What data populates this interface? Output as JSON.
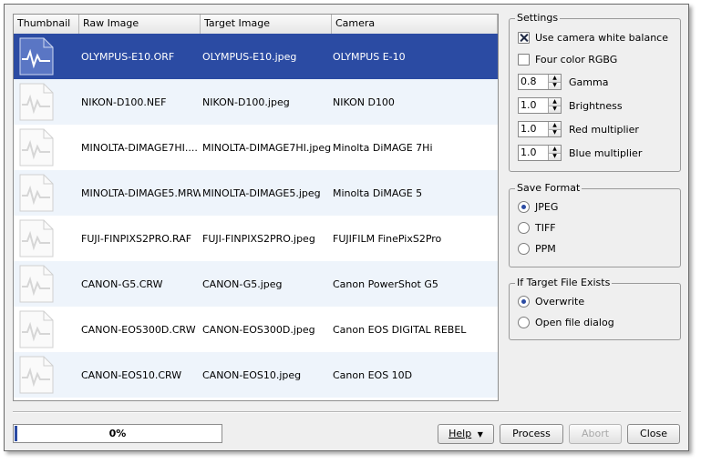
{
  "list": {
    "columns": [
      "Thumbnail",
      "Raw Image",
      "Target Image",
      "Camera"
    ],
    "rows": [
      {
        "raw": "OLYMPUS-E10.ORF",
        "target": "OLYMPUS-E10.jpeg",
        "camera": "OLYMPUS E-10"
      },
      {
        "raw": "NIKON-D100.NEF",
        "target": "NIKON-D100.jpeg",
        "camera": "NIKON D100"
      },
      {
        "raw": "MINOLTA-DIMAGE7HI....",
        "target": "MINOLTA-DIMAGE7HI.jpeg",
        "camera": "Minolta DiMAGE 7Hi"
      },
      {
        "raw": "MINOLTA-DIMAGE5.MRW",
        "target": "MINOLTA-DIMAGE5.jpeg",
        "camera": "Minolta DiMAGE 5"
      },
      {
        "raw": "FUJI-FINPIXS2PRO.RAF",
        "target": "FUJI-FINPIXS2PRO.jpeg",
        "camera": "FUJIFILM FinePixS2Pro"
      },
      {
        "raw": "CANON-G5.CRW",
        "target": "CANON-G5.jpeg",
        "camera": "Canon PowerShot G5"
      },
      {
        "raw": "CANON-EOS300D.CRW",
        "target": "CANON-EOS300D.jpeg",
        "camera": "Canon EOS DIGITAL REBEL"
      },
      {
        "raw": "CANON-EOS10.CRW",
        "target": "CANON-EOS10.jpeg",
        "camera": "Canon EOS 10D"
      }
    ],
    "selected_row": 0
  },
  "settings": {
    "title": "Settings",
    "white_balance": "Use camera white balance",
    "four_color": "Four color RGBG",
    "gamma_label": "Gamma",
    "gamma_value": "0.8",
    "brightness_label": "Brightness",
    "brightness_value": "1.0",
    "red_label": "Red multiplier",
    "red_value": "1.0",
    "blue_label": "Blue multiplier",
    "blue_value": "1.0"
  },
  "save_format": {
    "title": "Save Format",
    "options": [
      "JPEG",
      "TIFF",
      "PPM"
    ],
    "selected": "JPEG"
  },
  "target_exists": {
    "title": "If Target File Exists",
    "options": [
      "Overwrite",
      "Open file dialog"
    ],
    "selected": "Overwrite"
  },
  "progress": {
    "text": "0%",
    "value": 0
  },
  "buttons": {
    "help": "Help",
    "process": "Process",
    "abort": "Abort",
    "close": "Close"
  },
  "colors": {
    "selection": "#2b4ba3",
    "alt_row": "#eef4fb"
  },
  "icons": {
    "thumbnail": "image-placeholder-icon",
    "help_arrow": "triangle-down-icon",
    "spin_arrows": "spin-up-down-icon"
  }
}
